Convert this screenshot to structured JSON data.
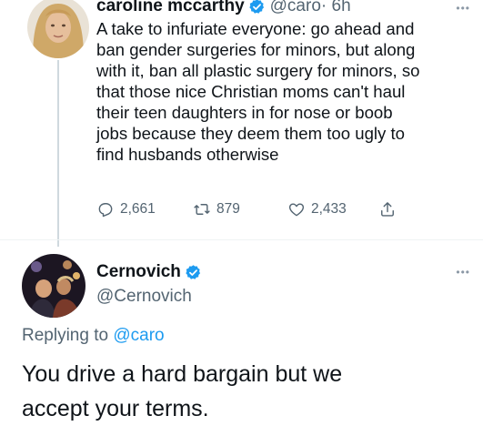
{
  "tweet1": {
    "name": "caroline mccarthy",
    "handle": "@caro",
    "time": " · 6h",
    "verified_icon": "verified-badge-icon",
    "more_icon": "more-options-icon",
    "text_lines": [
      "A take to infuriate everyone: go ahead and",
      "ban gender surgeries for minors, but along",
      "with it, ban all plastic surgery for minors, so",
      "that those nice Christian moms can't haul",
      "their teen daughters in for nose or boob",
      "jobs because they deem them too ugly to",
      "find husbands otherwise"
    ],
    "actions": {
      "replies": "2,661",
      "retweets": "879",
      "likes": "2,433",
      "icons": [
        "reply-icon",
        "retweet-icon",
        "like-icon",
        "share-icon"
      ]
    }
  },
  "tweet2": {
    "name": "Cernovich",
    "handle": "@Cernovich",
    "verified_icon": "verified-badge-icon",
    "more_icon": "more-options-icon",
    "replying_prefix": "Replying to ",
    "replying_to": "@caro",
    "text_lines": [
      "You drive a hard bargain but we",
      "accept your terms."
    ]
  },
  "colors": {
    "verified": "#1d9bf0",
    "link": "#1d9bf0",
    "secondary_text": "#536471",
    "primary_text": "#0f1419"
  }
}
